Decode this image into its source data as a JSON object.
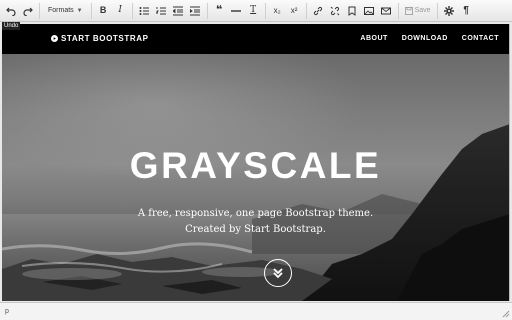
{
  "toolbar": {
    "tooltip": "Undo",
    "formats_label": "Formats",
    "bold_label": "B",
    "italic_label": "I",
    "blockquote_label": "❝",
    "clear_format_label": "T",
    "subscript_label": "x₂",
    "superscript_label": "x²",
    "save_label": "Save",
    "pilcrow_label": "¶"
  },
  "navbar": {
    "brand": "START BOOTSTRAP",
    "links": [
      "ABOUT",
      "DOWNLOAD",
      "CONTACT"
    ]
  },
  "hero": {
    "title": "GRAYSCALE",
    "subtitle_line1": "A free, responsive, one page Bootstrap theme.",
    "subtitle_line2": "Created by Start Bootstrap."
  },
  "statusbar": {
    "path": "p"
  },
  "colors": {
    "navbar_bg": "#000000",
    "text_light": "#ffffff",
    "toolbar_bg": "#f0f0f0"
  }
}
